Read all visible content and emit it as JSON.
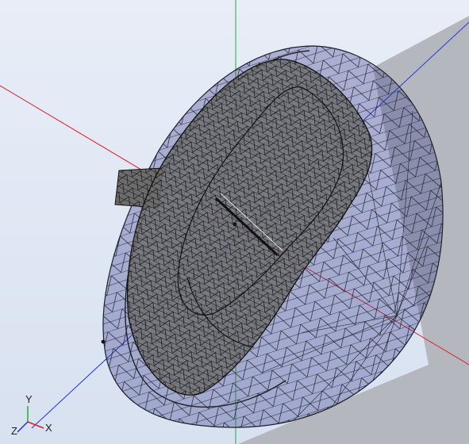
{
  "viewport": {
    "background": "#e2e9f5",
    "shell_fill": "#3c3f90",
    "part_fill": "#6d6d6d",
    "mesh_color": "#1f1f2a",
    "backdrop": "#b4b8be"
  },
  "axes": {
    "x_color": "#e0202a",
    "y_color": "#20b030",
    "z_color": "#2030e0"
  },
  "labels": {
    "top_label": "",
    "bottom_label": ""
  },
  "triad": {
    "x_label": "X",
    "y_label": "Y",
    "z_label": "Z"
  }
}
